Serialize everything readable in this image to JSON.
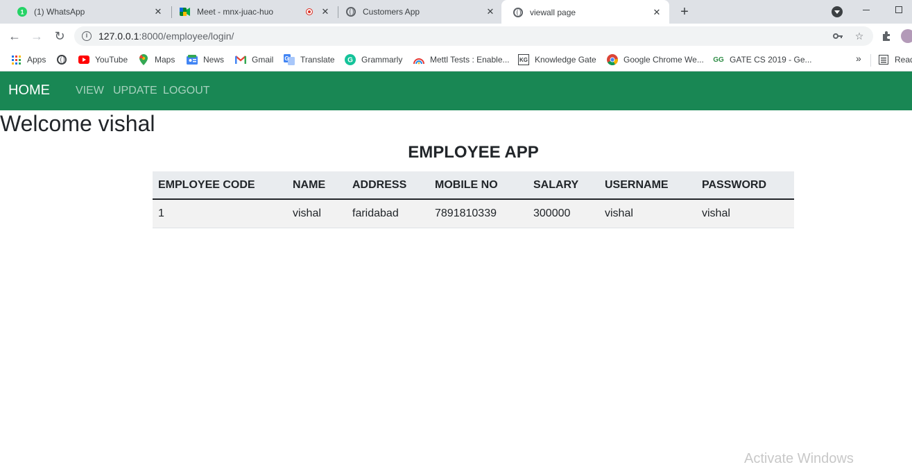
{
  "browser": {
    "tabs": [
      {
        "title": "(1) WhatsApp",
        "icon": "whatsapp-icon",
        "badge": "1"
      },
      {
        "title": "Meet - mnx-juac-huo",
        "icon": "google-meet-icon"
      },
      {
        "title": "Customers App",
        "icon": "globe-icon"
      },
      {
        "title": "viewall page",
        "icon": "globe-icon",
        "active": true
      }
    ],
    "close_glyph": "✕",
    "new_tab_glyph": "+",
    "url_host": "127.0.0.1",
    "url_path": ":8000/employee/login/",
    "bookmarks": [
      {
        "label": "Apps",
        "icon": "apps-grid-icon"
      },
      {
        "label": "",
        "icon": "globe-icon"
      },
      {
        "label": "YouTube",
        "icon": "youtube-icon"
      },
      {
        "label": "Maps",
        "icon": "maps-icon"
      },
      {
        "label": "News",
        "icon": "news-icon"
      },
      {
        "label": "Gmail",
        "icon": "gmail-icon"
      },
      {
        "label": "Translate",
        "icon": "translate-icon"
      },
      {
        "label": "Grammarly",
        "icon": "grammarly-icon"
      },
      {
        "label": "Mettl Tests : Enable...",
        "icon": "mettl-icon"
      },
      {
        "label": "Knowledge Gate",
        "icon": "knowledge-gate-icon"
      },
      {
        "label": "Google Chrome We...",
        "icon": "chrome-icon"
      },
      {
        "label": "GATE CS 2019 - Ge...",
        "icon": "geeksforgeeks-icon"
      }
    ],
    "bookmarks_more": "»",
    "reading_list": "Read"
  },
  "page": {
    "brand": "HOME",
    "nav_links": [
      "VIEW",
      "UPDATE",
      "LOGOUT"
    ],
    "welcome": "Welcome vishal",
    "app_title": "EMPLOYEE APP",
    "table": {
      "headers": [
        "EMPLOYEE CODE",
        "NAME",
        "ADDRESS",
        "MOBILE NO",
        "SALARY",
        "USERNAME",
        "PASSWORD"
      ],
      "rows": [
        [
          "1",
          "vishal",
          "faridabad",
          "7891810339",
          "300000",
          "vishal",
          "vishal"
        ]
      ]
    }
  },
  "watermark": "Activate Windows",
  "colors": {
    "navbar": "#198754",
    "tabstrip": "#dee1e6"
  }
}
